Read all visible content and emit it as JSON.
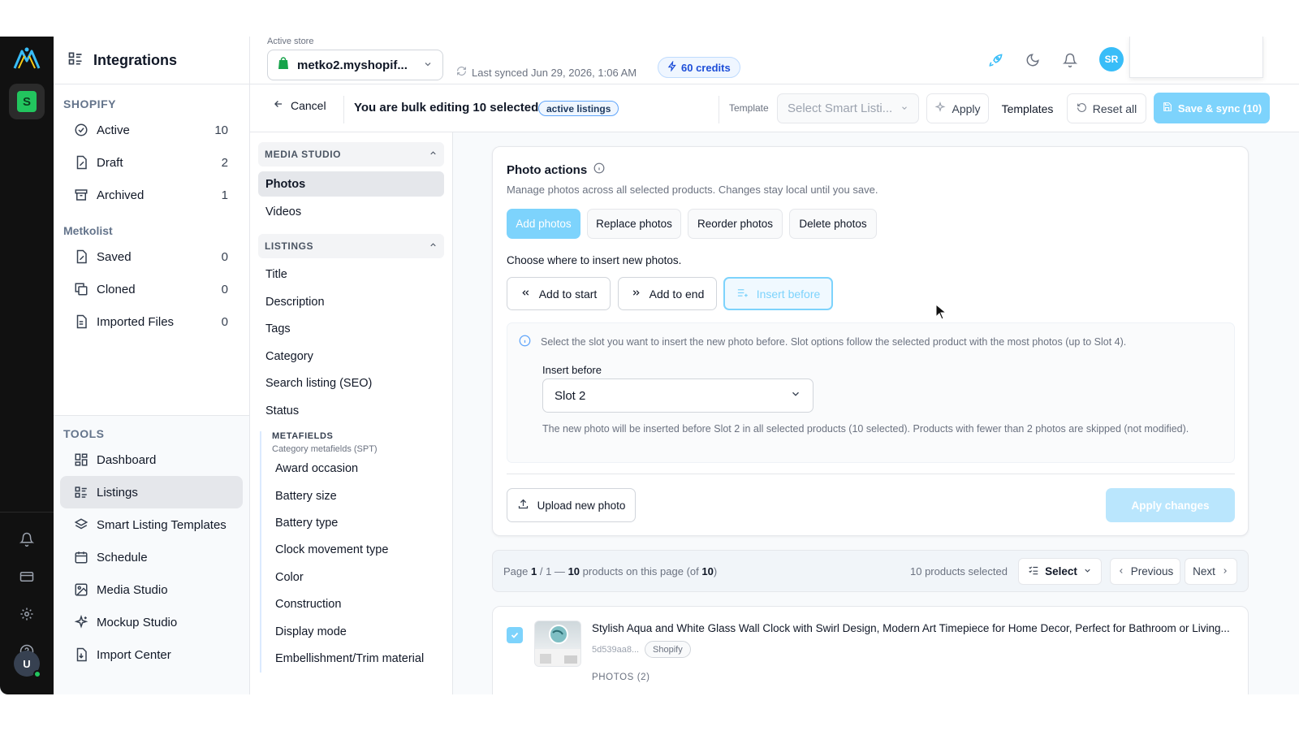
{
  "rail": {
    "logo_icon": "metkolist-logo-icon",
    "shop_icon": "shopify-bag-icon",
    "bottom_icons": [
      "bell-icon",
      "card-icon",
      "gear-icon",
      "help-icon"
    ],
    "avatar_initial": "U"
  },
  "sidebar": {
    "title": "Integrations",
    "shopify_heading": "SHOPIFY",
    "shopify_items": [
      {
        "label": "Active",
        "count": "10",
        "icon": "check-circle-icon"
      },
      {
        "label": "Draft",
        "count": "2",
        "icon": "draft-icon"
      },
      {
        "label": "Archived",
        "count": "1",
        "icon": "archive-icon"
      }
    ],
    "metkolist_heading": "Metkolist",
    "metkolist_items": [
      {
        "label": "Saved",
        "count": "0",
        "icon": "saved-icon"
      },
      {
        "label": "Cloned",
        "count": "0",
        "icon": "clone-icon"
      },
      {
        "label": "Imported Files",
        "count": "0",
        "icon": "file-icon"
      }
    ],
    "tools_heading": "TOOLS",
    "tools_items": [
      {
        "label": "Dashboard",
        "icon": "dashboard-icon"
      },
      {
        "label": "Listings",
        "icon": "listings-icon",
        "active": true
      },
      {
        "label": "Smart Listing Templates",
        "icon": "layers-icon"
      },
      {
        "label": "Schedule",
        "icon": "calendar-icon"
      },
      {
        "label": "Media Studio",
        "icon": "image-icon"
      },
      {
        "label": "Mockup Studio",
        "icon": "sparkle-icon"
      },
      {
        "label": "Import Center",
        "icon": "import-icon"
      }
    ]
  },
  "topbar": {
    "active_store_label": "Active store",
    "store_name": "metko2.myshopif...",
    "last_synced": "Last synced Jun 29, 2026, 1:06 AM",
    "credits": "60 credits",
    "user_initials": "SR"
  },
  "bulkbar": {
    "cancel": "Cancel",
    "title": "You are bulk editing 10 selected",
    "badge": "active listings",
    "template_label": "Template",
    "template_placeholder": "Select Smart Listi...",
    "apply": "Apply",
    "templates": "Templates",
    "reset_all": "Reset all",
    "save_sync": "Save & sync (10)"
  },
  "midnav": {
    "media_heading": "MEDIA STUDIO",
    "media_items": [
      "Photos",
      "Videos"
    ],
    "listings_heading": "LISTINGS",
    "listing_items": [
      "Title",
      "Description",
      "Tags",
      "Category",
      "Search listing (SEO)",
      "Status"
    ],
    "metafields_heading": "METAFIELDS",
    "metafields_sub": "Category metafields (SPT)",
    "metafield_items": [
      "Award occasion",
      "Battery size",
      "Battery type",
      "Clock movement type",
      "Color",
      "Construction",
      "Display mode",
      "Embellishment/Trim material"
    ]
  },
  "photo_actions": {
    "title": "Photo actions",
    "subtitle": "Manage photos across all selected products. Changes stay local until you save.",
    "actions": [
      "Add photos",
      "Replace photos",
      "Reorder photos",
      "Delete photos"
    ],
    "choose_label": "Choose where to insert new photos.",
    "positions": [
      "Add to start",
      "Add to end",
      "Insert before"
    ],
    "info": "Select the slot you want to insert the new photo before. Slot options follow the selected product with the most photos (up to Slot 4).",
    "insert_before_label": "Insert before",
    "slot_value": "Slot 2",
    "note": "The new photo will be inserted before Slot 2 in all selected products (10 selected). Products with fewer than 2 photos are skipped (not modified).",
    "upload": "Upload new photo",
    "apply_changes": "Apply changes"
  },
  "pager": {
    "page_prefix": "Page",
    "page_num": "1",
    "page_sep": "/ 1 —",
    "count": "10",
    "mid_text": "products on this page (of",
    "total": "10",
    "close": ")",
    "selected": "10 products selected",
    "select": "Select",
    "previous": "Previous",
    "next": "Next"
  },
  "product": {
    "title": "Stylish Aqua and White Glass Wall Clock with Swirl Design, Modern Art Timepiece for Home Decor, Perfect for Bathroom or Living...",
    "id": "5d539aa8...",
    "channel": "Shopify",
    "photos": "PHOTOS (2)"
  }
}
